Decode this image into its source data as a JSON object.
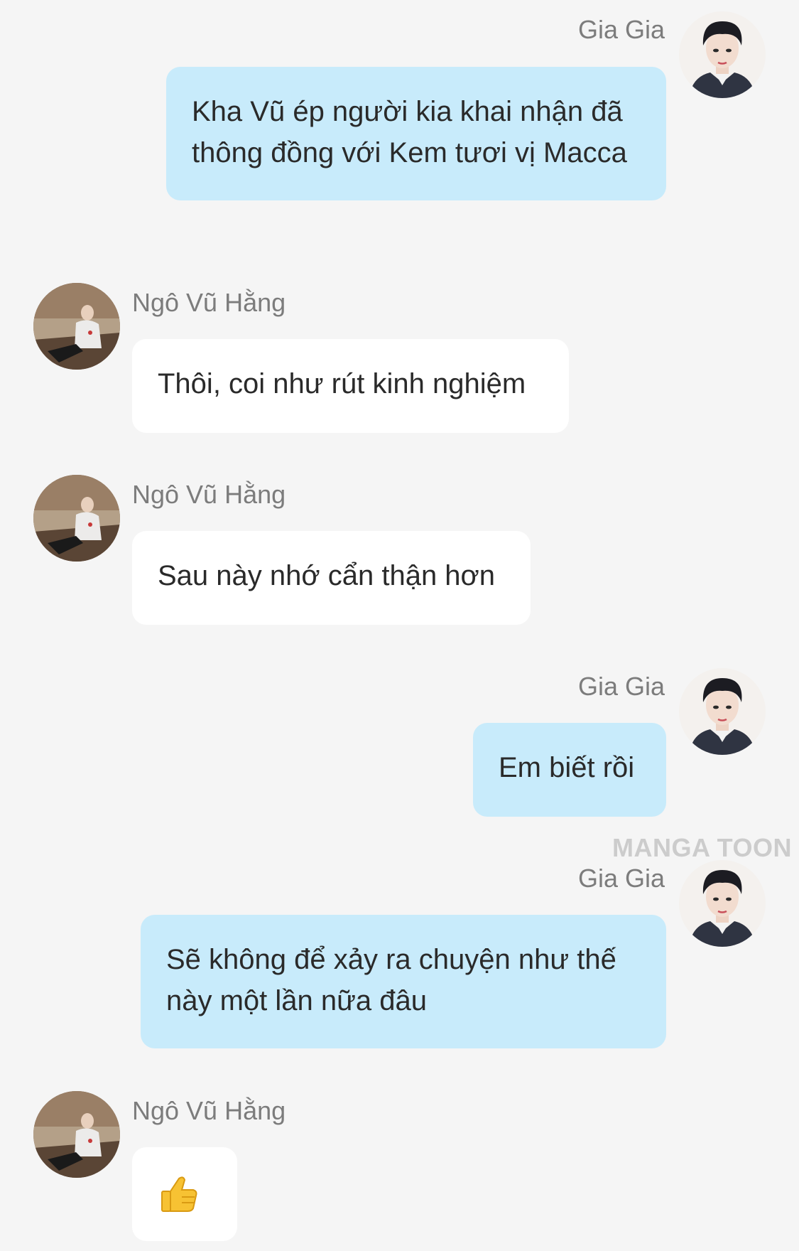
{
  "colors": {
    "background": "#f5f5f5",
    "outgoing_bubble": "#c8ebfb",
    "incoming_bubble": "#ffffff",
    "name_text": "#7c7c7c"
  },
  "messages": [
    {
      "sender": "Gia Gia",
      "direction": "outgoing",
      "lines": [
        "Kha Vũ ép người kia khai nhận đã",
        "thông đồng với Kem tươi vị Macca"
      ]
    },
    {
      "sender": "Ngô Vũ Hằng",
      "direction": "incoming",
      "lines": [
        "Thôi, coi như rút kinh nghiệm"
      ]
    },
    {
      "sender": "Ngô Vũ Hằng",
      "direction": "incoming",
      "lines": [
        "Sau này nhớ cẩn thận hơn"
      ]
    },
    {
      "sender": "Gia Gia",
      "direction": "outgoing",
      "lines": [
        "Em biết rồi"
      ]
    },
    {
      "sender": "Gia Gia",
      "direction": "outgoing",
      "lines": [
        "Sẽ không để xảy ra chuyện như thế",
        "này một lần nữa đâu"
      ]
    },
    {
      "sender": "Ngô Vũ Hằng",
      "direction": "incoming",
      "lines": [
        "👍"
      ],
      "icon": "thumbs-up-emoji"
    }
  ],
  "watermark": "MANGA TOON"
}
